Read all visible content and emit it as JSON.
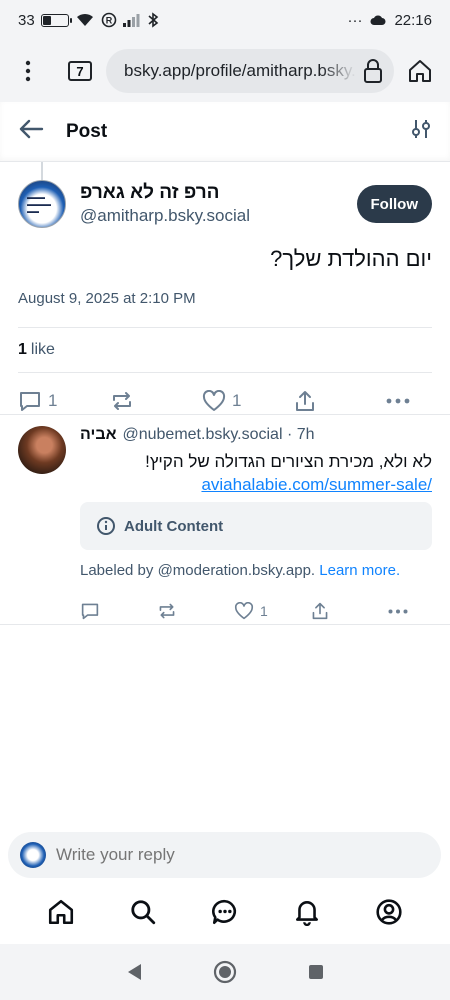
{
  "status_bar": {
    "battery_text": "33",
    "battery_level": 0.33,
    "time": "22:16",
    "dots": "···"
  },
  "browser": {
    "tab_count": "7",
    "url": "bsky.app/profile/amitharp.bsky.social"
  },
  "header": {
    "title": "Post"
  },
  "post": {
    "author_name": "הרפ זה לא גארפ",
    "author_handle": "@amitharp.bsky.social",
    "follow_label": "Follow",
    "text": "יום ההולדת שלך?",
    "date": "August 9, 2025 at 2:10 PM",
    "like_count": "1",
    "like_word": "like",
    "reply_count": "1",
    "repost_count": "",
    "heart_count": "1"
  },
  "reply": {
    "author_name": "אביה",
    "author_meta": "@nubemet.bsky.social · 7h",
    "text": "לא ולא, מכירת הציורים הגדולה של הקיץ!",
    "link": "aviahalabie.com/summer-sale/",
    "adult_label": "Adult Content",
    "labeled_by": "Labeled by @moderation.bsky.app.",
    "learn_more": "Learn more.",
    "heart_count": "1"
  },
  "composer": {
    "placeholder": "Write your reply"
  },
  "colors": {
    "accent": "#1083fe",
    "follow_bg": "#2b3a4a",
    "muted": "#42576c",
    "icon": "#6e8093"
  }
}
